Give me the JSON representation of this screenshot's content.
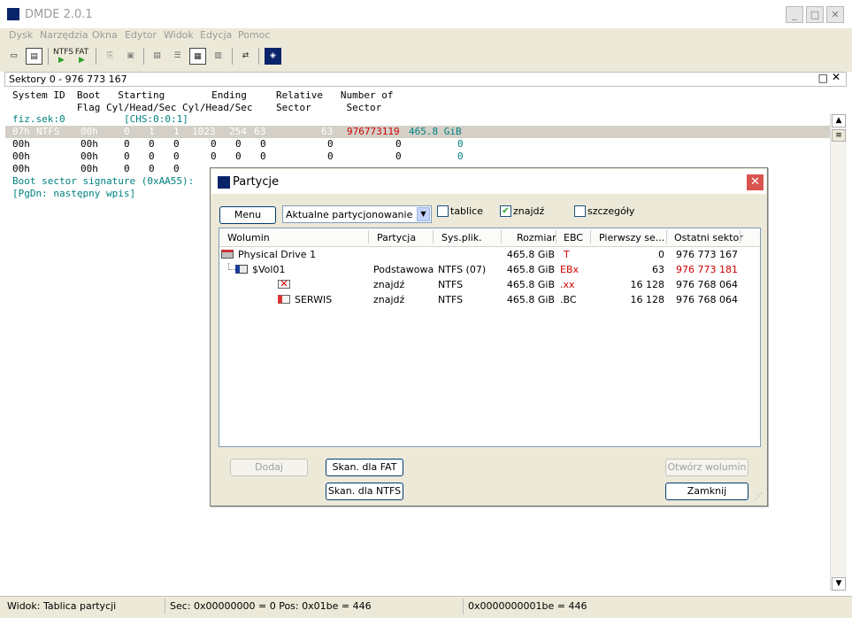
{
  "app": {
    "title": "DMDE 2.0.1"
  },
  "menu": [
    "Dysk",
    "Narzędzia",
    "Okna",
    "Edytor",
    "Widok",
    "Edycja",
    "Pomoc"
  ],
  "toolbar": {
    "ntfs_label": "NTFS",
    "fat_label": "FAT"
  },
  "panel": {
    "title": "Sektory 0 - 976 773 167"
  },
  "table_header": {
    "line1": "System ID  Boot   Starting        Ending     Relative   Number of",
    "line2": "           Flag Cyl/Head/Sec Cyl/Head/Sec    Sector      Sector"
  },
  "content": {
    "phys_label": "fiz.sek:0",
    "chs": "[CHS:0:0:1]",
    "entries": [
      {
        "id": "07h",
        "fs": "NTFS",
        "flag": "00h",
        "sc": "0",
        "sh": "1",
        "ss": "1",
        "ec": "1023",
        "eh": "254",
        "es": "63",
        "rel": "63",
        "num": "976773119",
        "size": "465.8 GiB"
      },
      {
        "id": "00h",
        "fs": "",
        "flag": "00h",
        "sc": "0",
        "sh": "0",
        "ss": "0",
        "ec": "0",
        "eh": "0",
        "es": "0",
        "rel": "0",
        "num": "0",
        "num2": "0"
      },
      {
        "id": "00h",
        "fs": "",
        "flag": "00h",
        "sc": "0",
        "sh": "0",
        "ss": "0",
        "ec": "0",
        "eh": "0",
        "es": "0",
        "rel": "0",
        "num": "0",
        "num2": "0"
      },
      {
        "id": "00h",
        "fs": "",
        "flag": "00h",
        "sc": "0",
        "sh": "0",
        "ss": "0"
      }
    ],
    "signature": "Boot sector signature (0xAA55):",
    "pgdn": "[PgDn: następny wpis]"
  },
  "status": {
    "view": "Widok: Tablica partycji",
    "sec": "Sec: 0x00000000 = 0  Pos: 0x01be = 446",
    "hex": "0x0000000001be = 446"
  },
  "dialog": {
    "title": "Partycje",
    "menu_button": "Menu",
    "combo_value": "Aktualne partycjonowanie",
    "checks": [
      {
        "label": "tablice",
        "checked": false
      },
      {
        "label": "znajdź",
        "checked": true
      },
      {
        "label": "szczegóły",
        "checked": false
      }
    ],
    "columns": [
      "Wolumin",
      "Partycja",
      "Sys.plik.",
      "Rozmiar",
      "EBC",
      "Pierwszy se...",
      "Ostatni sektor"
    ],
    "rows": [
      {
        "wolumin": "Physical Drive 1",
        "partycja": "",
        "fs": "",
        "size": "465.8 GiB",
        "ebc": "T",
        "first": "0",
        "last": "976 773 167",
        "icon": "drive-icon",
        "indent": 0
      },
      {
        "wolumin": "$Vol01",
        "partycja": "Podstawowa",
        "fs": "NTFS (07)",
        "size": "465.8 GiB",
        "ebc": "EBx",
        "first": "63",
        "last": "976 773 181",
        "icon": "volume-icon",
        "indent": 1,
        "last_red": true
      },
      {
        "wolumin": "",
        "partycja": "znajdź",
        "fs": "NTFS",
        "size": "465.8 GiB",
        "ebc": ".xx",
        "first": "16 128",
        "last": "976 768 064",
        "icon": "deleted-volume-icon",
        "indent": 2
      },
      {
        "wolumin": "SERWIS",
        "partycja": "znajdź",
        "fs": "NTFS",
        "size": "465.8 GiB",
        "ebc": ".BC",
        "first": "16 128",
        "last": "976 768 064",
        "icon": "found-volume-icon",
        "indent": 2
      }
    ],
    "buttons": {
      "add": "Dodaj",
      "scan_fat": "Skan. dla FAT",
      "scan_ntfs": "Skan. dla NTFS",
      "open_volume": "Otwórz wolumin",
      "close": "Zamknij"
    }
  }
}
